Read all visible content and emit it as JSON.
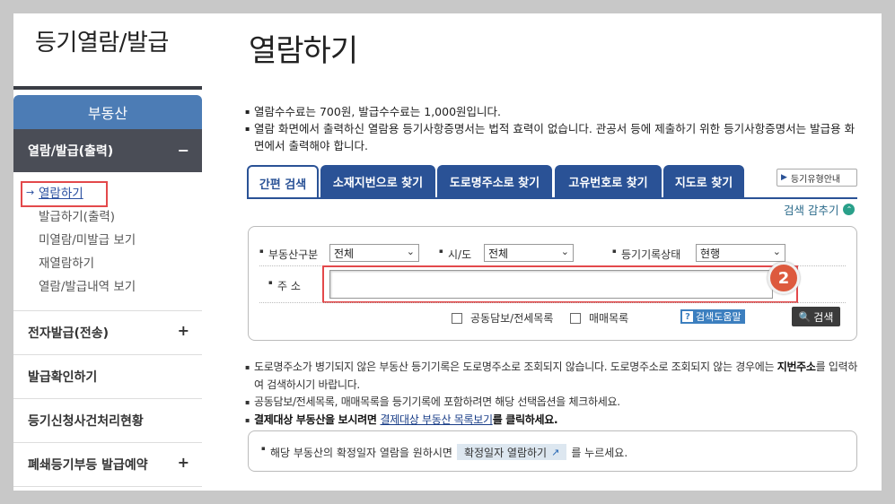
{
  "sidebar": {
    "title": "등기열람/발급",
    "category": "부동산",
    "sub_header": "열람/발급(출력)",
    "sub_toggle": "−",
    "sub_items": [
      {
        "label": "열람하기",
        "arrow": "→"
      },
      {
        "label": "발급하기(출력)"
      },
      {
        "label": "미열람/미발급 보기"
      },
      {
        "label": "재열람하기"
      },
      {
        "label": "열람/발급내역 보기"
      }
    ],
    "items": [
      {
        "label": "전자발급(전송)",
        "toggle": "+"
      },
      {
        "label": "발급확인하기"
      },
      {
        "label": "등기신청사건처리현황"
      },
      {
        "label": "폐쇄등기부등 발급예약",
        "toggle": "+"
      }
    ]
  },
  "main": {
    "title": "열람하기",
    "notes": [
      "열람수수료는 700원, 발급수수료는 1,000원입니다.",
      "열람 화면에서 출력하신 열람용 등기사항증명서는 법적 효력이 없습니다. 관공서 등에 제출하기 위한 등기사항증명서는 발급용 화면에서 출력해야 합니다."
    ],
    "tabs": [
      "간편 검색",
      "소재지번으로 찾기",
      "도로명주소로 찾기",
      "고유번호로 찾기",
      "지도로 찾기"
    ],
    "guide_button": "등기유형안내",
    "collapse_label": "검색 감추기",
    "collapse_icon": "⌃",
    "search": {
      "property_type_label": "부동산구분",
      "property_type_value": "전체",
      "sido_label": "시/도",
      "sido_value": "전체",
      "record_status_label": "등기기록상태",
      "record_status_value": "현행",
      "address_label": "주 소",
      "address_value": "",
      "badge": "2",
      "checkbox_joint": "공동담보/전세목록",
      "checkbox_trade": "매매목록",
      "help_label": "검색도움말",
      "search_button": "검색"
    },
    "notes2": {
      "n1a": "도로명주소가 병기되지 않은 부동산 등기기록은 도로명주소로 조회되지 않습니다. 도로명주소로 조회되지 않는 경우에는 ",
      "n1b": "지번주소",
      "n1c": "를 입력하여 검색하시기 바랍니다.",
      "n2": "공동담보/전세목록, 매매목록을 등기기록에 포함하려면 해당 선택옵션을 체크하세요.",
      "n3a": "결제대상 부동산을 보시려면 ",
      "n3link": "결제대상 부동산 목록보기",
      "n3b": "를 클릭하세요."
    },
    "confirm": {
      "text_before": "해당 부동산의 확정일자 열람을 원하시면",
      "button": "확정일자 열람하기",
      "text_after": "를 누르세요."
    }
  }
}
